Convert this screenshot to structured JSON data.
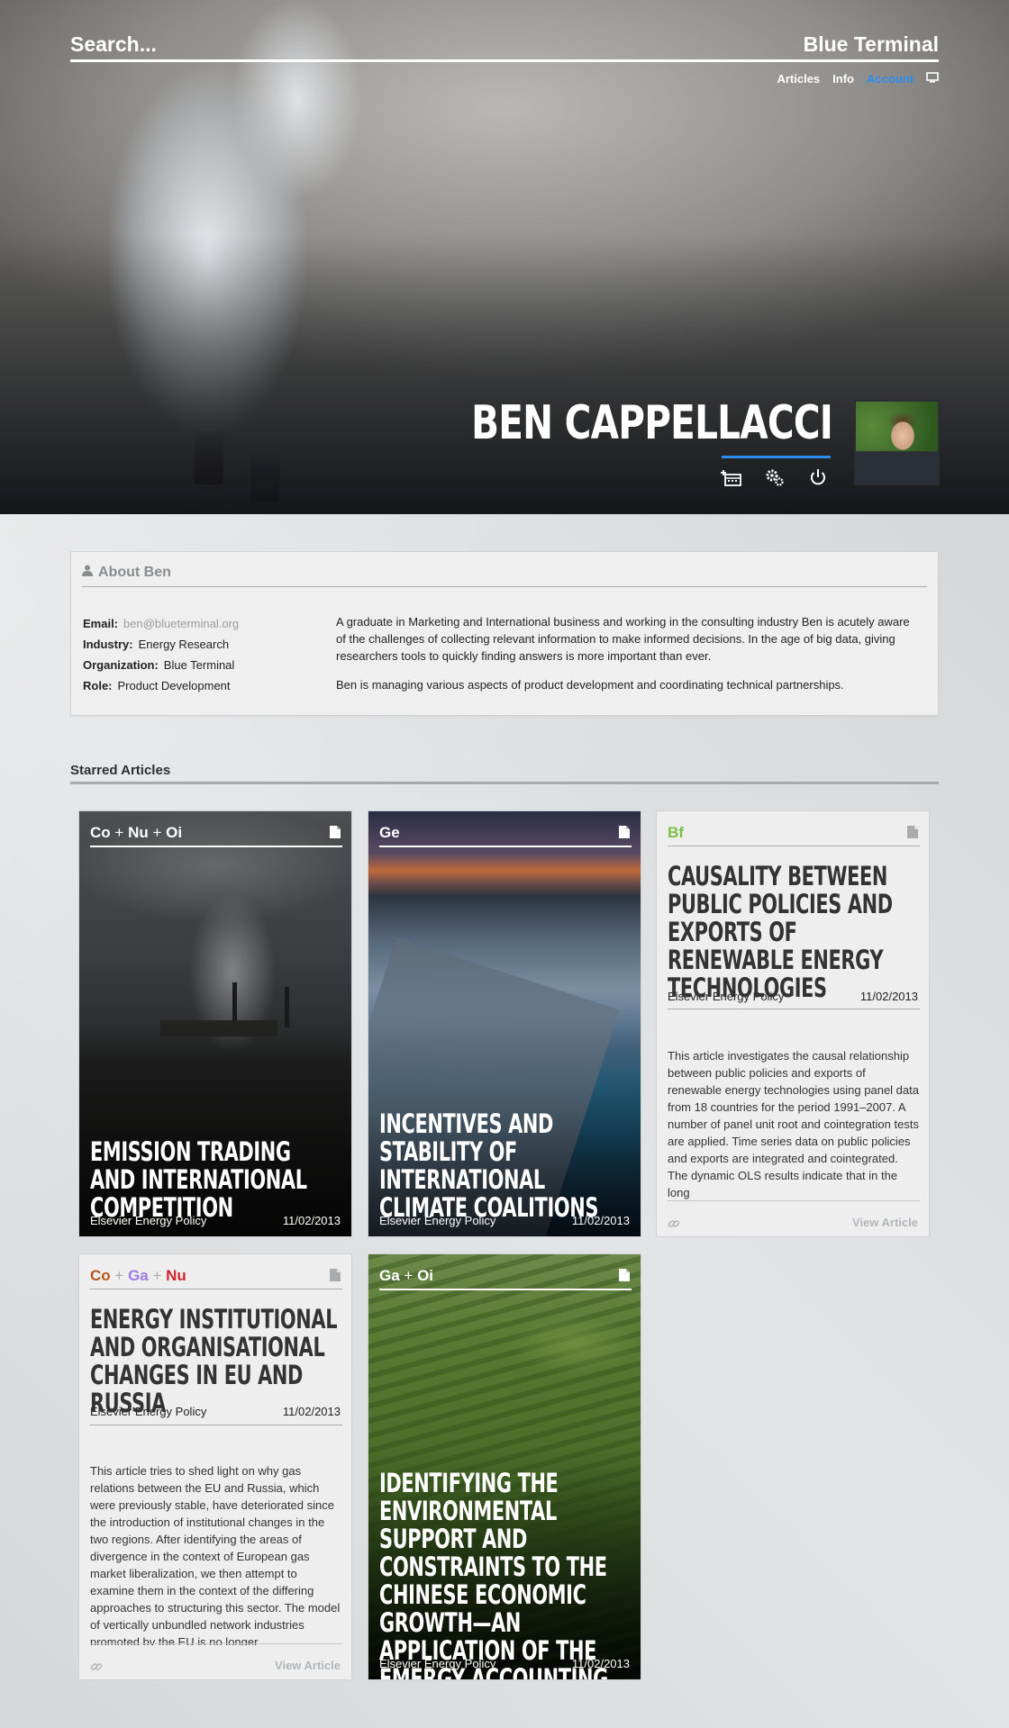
{
  "header": {
    "search_placeholder": "Search...",
    "brand": "Blue Terminal",
    "nav": [
      {
        "label": "Articles"
      },
      {
        "label": "Info"
      },
      {
        "label": "Account",
        "active": true
      }
    ],
    "nav_icon": "monitor-icon",
    "accent_color": "#2a8bf0"
  },
  "profile": {
    "name": "BEN CAPPELLACCI",
    "actions": [
      "add-to-calendar-icon",
      "settings-gears-icon",
      "power-icon"
    ]
  },
  "about": {
    "title": "About Ben",
    "fields": [
      {
        "label": "Email:",
        "value": "ben@blueterminal.org"
      },
      {
        "label": "Industry:",
        "value": "Energy Research"
      },
      {
        "label": "Organization:",
        "value": "Blue Terminal"
      },
      {
        "label": "Role:",
        "value": "Product Development"
      }
    ],
    "paragraphs": [
      "A graduate in Marketing and International business and working in the consulting industry Ben is acutely aware of the challenges of collecting relevant information to make informed decisions. In the age of big data, giving researchers tools to quickly finding answers is more important than ever.",
      "Ben is managing various aspects of product development and coordinating technical partnerships."
    ]
  },
  "starred": {
    "title": "Starred Articles",
    "cards": [
      {
        "tags": [
          {
            "text": "Co",
            "color": "#ffffff"
          },
          {
            "text": "Nu",
            "color": "#ffffff"
          },
          {
            "text": "Oi",
            "color": "#ffffff"
          }
        ],
        "title": "Emission Trading and International Competition",
        "source": "Elsevier Energy Policy",
        "date": "11/02/2013",
        "style": "dark-image"
      },
      {
        "tags": [
          {
            "text": "Ge",
            "color": "#ffffff"
          }
        ],
        "title": "Incentives and Stability of International Climate Coalitions",
        "source": "Elsevier Energy Policy",
        "date": "11/02/2013",
        "style": "dark-image"
      },
      {
        "tags": [
          {
            "text": "Bf",
            "color": "#7ac143"
          }
        ],
        "title": "Causality Between Public Policies and Exports of Renewable Energy Technologies",
        "source": "Elsevier Energy Policy",
        "date": "11/02/2013",
        "abstract": "This article investigates the causal relationship between public policies and exports of renewable energy technologies using panel data from 18 countries for the period 1991–2007. A number of panel unit root and cointegration tests are applied. Time series data on public policies and exports are integrated and cointegrated. The dynamic OLS results indicate that in the long",
        "view_label": "View Article",
        "style": "light"
      },
      {
        "tags": [
          {
            "text": "Co",
            "color": "#b5561e"
          },
          {
            "text": "Ga",
            "color": "#a07be0"
          },
          {
            "text": "Nu",
            "color": "#d0242e"
          }
        ],
        "title": "Energy Institutional and Organisational Changes in EU and Russia",
        "source": "Elsevier Energy Policy",
        "date": "11/02/2013",
        "abstract": "This article tries to shed light on why gas relations between the EU and Russia, which were previously stable, have deteriorated since the introduction of institutional changes in the two regions. After identifying the areas of divergence in the context of European gas market liberalization, we then attempt to examine them in the context of the differing approaches to structuring this sector. The model of vertically unbundled network industries promoted by the EU is no longer",
        "view_label": "View Article",
        "style": "light"
      },
      {
        "tags": [
          {
            "text": "Ga",
            "color": "#ffffff"
          },
          {
            "text": "Oi",
            "color": "#ffffff"
          }
        ],
        "title": "Identifying the Environmental Support and Constraints to the Chinese Economic Growth—An Application of the Emergy Accounting Method",
        "source": "Elsevier Energy Policy",
        "date": "11/02/2013",
        "style": "dark-image"
      }
    ]
  }
}
